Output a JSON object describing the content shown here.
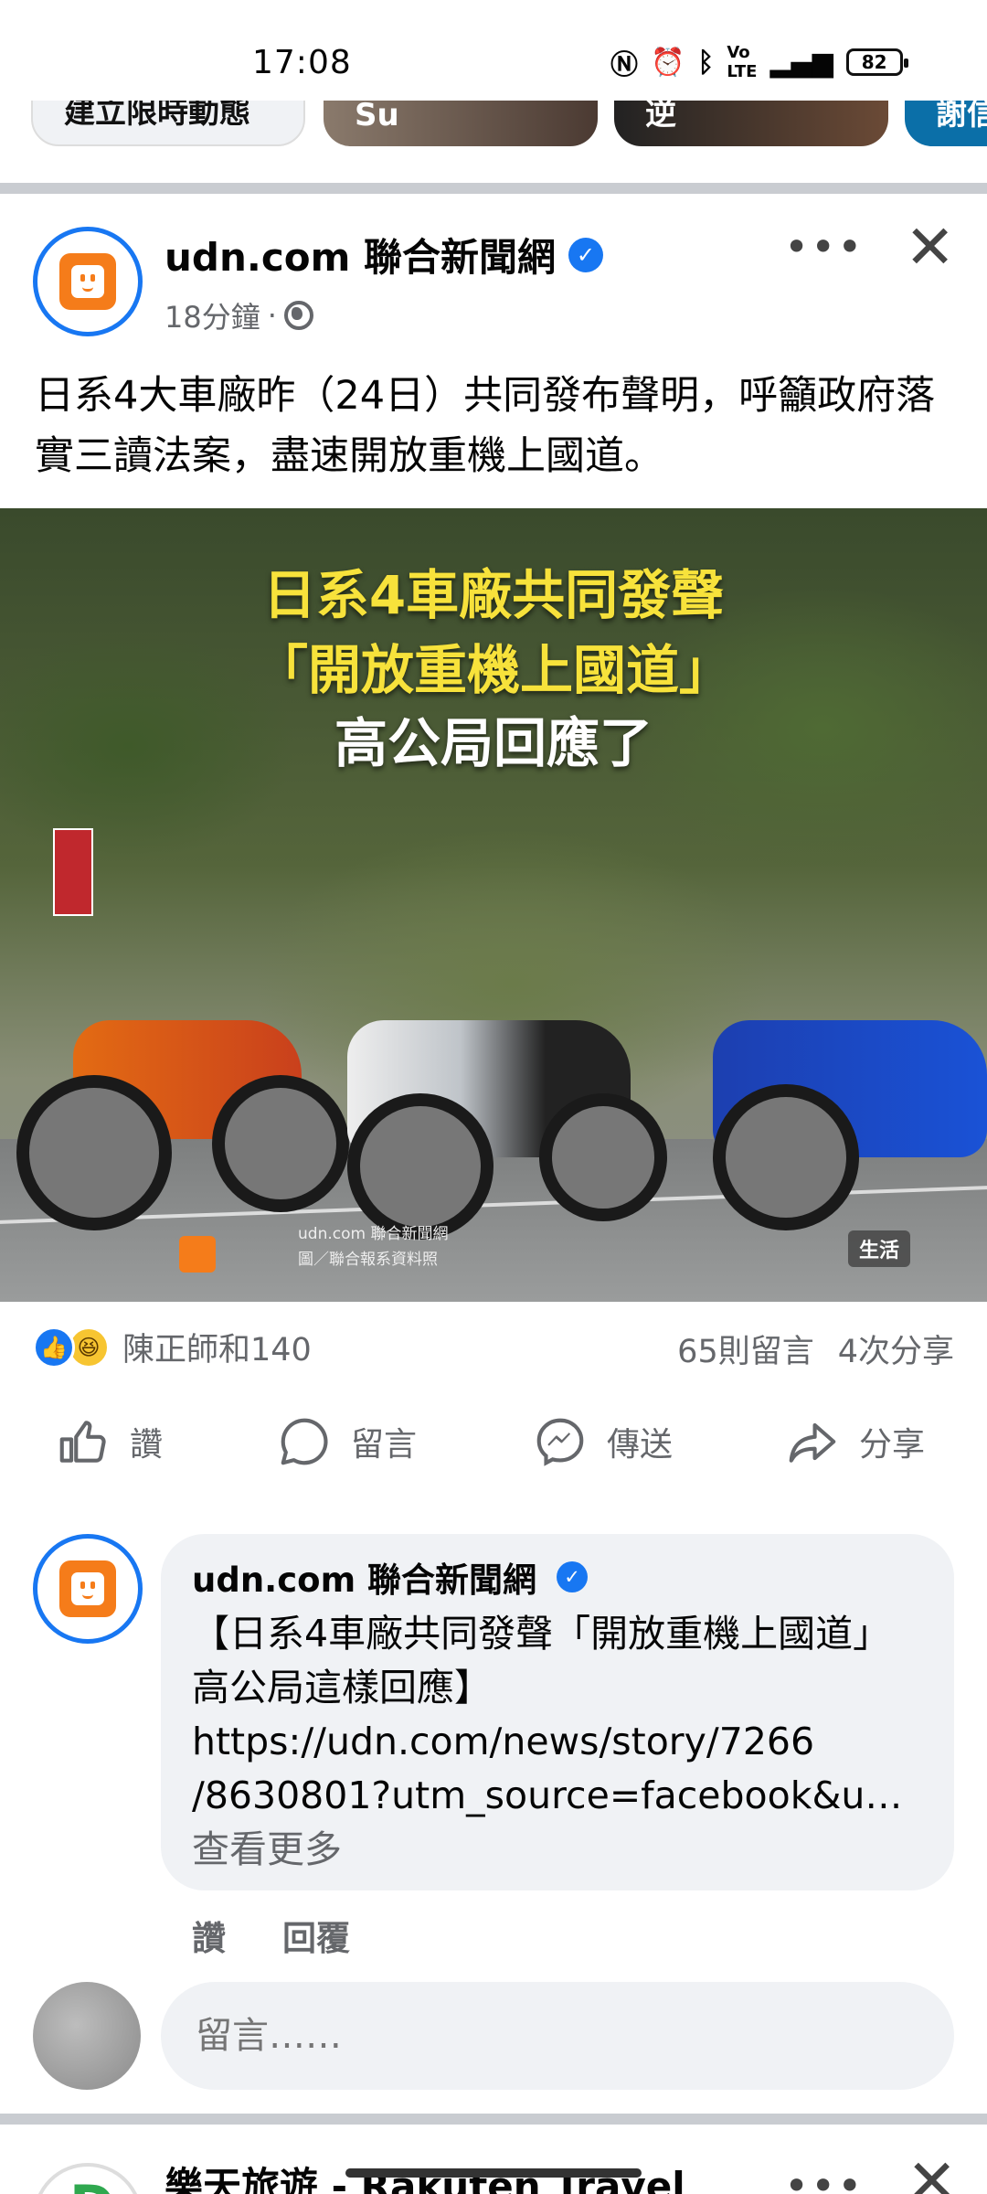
{
  "status_bar": {
    "time": "17:08",
    "icons": [
      "nfc-icon",
      "alarm-icon",
      "bluetooth-icon",
      "volte-icon",
      "4g-signal-icon"
    ],
    "battery": "82"
  },
  "stories": [
    "建立限時動態",
    "Su",
    "逆",
    "謝信"
  ],
  "post": {
    "page_name": "udn.com 聯合新聞網",
    "time": "18分鐘",
    "separator": "·",
    "text": "日系4大車廠昨（24日）共同發布聲明，呼籲政府落實三讀法案，盡速開放重機上國道。",
    "image": {
      "headline_1": "日系4車廠共同發聲",
      "headline_2": "「開放重機上國道」",
      "headline_3": "高公局回應了",
      "watermark_1": "udn.com 聯合新聞網",
      "watermark_2": "圖／聯合報系資料照",
      "category_tag": "生活",
      "headline_color": "#f7e23b"
    },
    "reactions_label": "陳正師和140",
    "comments_count": "65則留言",
    "shares_count": "4次分享",
    "actions": {
      "like": "讚",
      "comment": "留言",
      "send": "傳送",
      "share": "分享"
    }
  },
  "comment": {
    "author": "udn.com 聯合新聞網",
    "body": "【日系4車廠共同發聲「開放重機上國道」 高公局這樣回應】",
    "link_1": "https://udn.com/news/story/7266",
    "link_2": "/8630801?utm_source=facebook&u…",
    "see_more": "查看更多",
    "like": "讚",
    "reply": "回覆"
  },
  "comment_input": {
    "placeholder": "留言……"
  },
  "next_post": {
    "page_name": "樂天旅遊 - Rakuten Travel"
  },
  "colors": {
    "accent": "#1877f2",
    "brand_orange": "#f57c1a",
    "secondary_text": "#65676b"
  }
}
